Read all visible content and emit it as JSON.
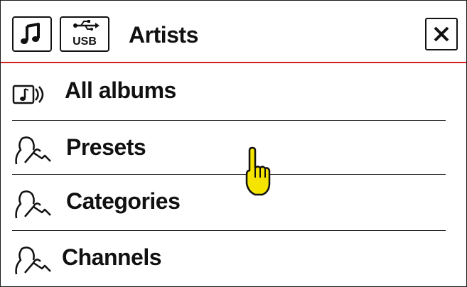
{
  "header": {
    "title": "Artists",
    "icons": {
      "music": "music-note-icon",
      "usb": "usb-icon",
      "close": "close-icon"
    },
    "usb_label": "USB",
    "accent": "#d6201f"
  },
  "list": {
    "items": [
      {
        "label": "All albums",
        "icon": "album-icon"
      },
      {
        "label": "Presets",
        "icon": "touch-hand-icon"
      },
      {
        "label": "Categories",
        "icon": "touch-hand-icon"
      },
      {
        "label": "Channels",
        "icon": "touch-hand-icon"
      }
    ]
  },
  "cursor": {
    "icon": "pointing-hand-cursor-icon",
    "color": "#f4e400"
  }
}
